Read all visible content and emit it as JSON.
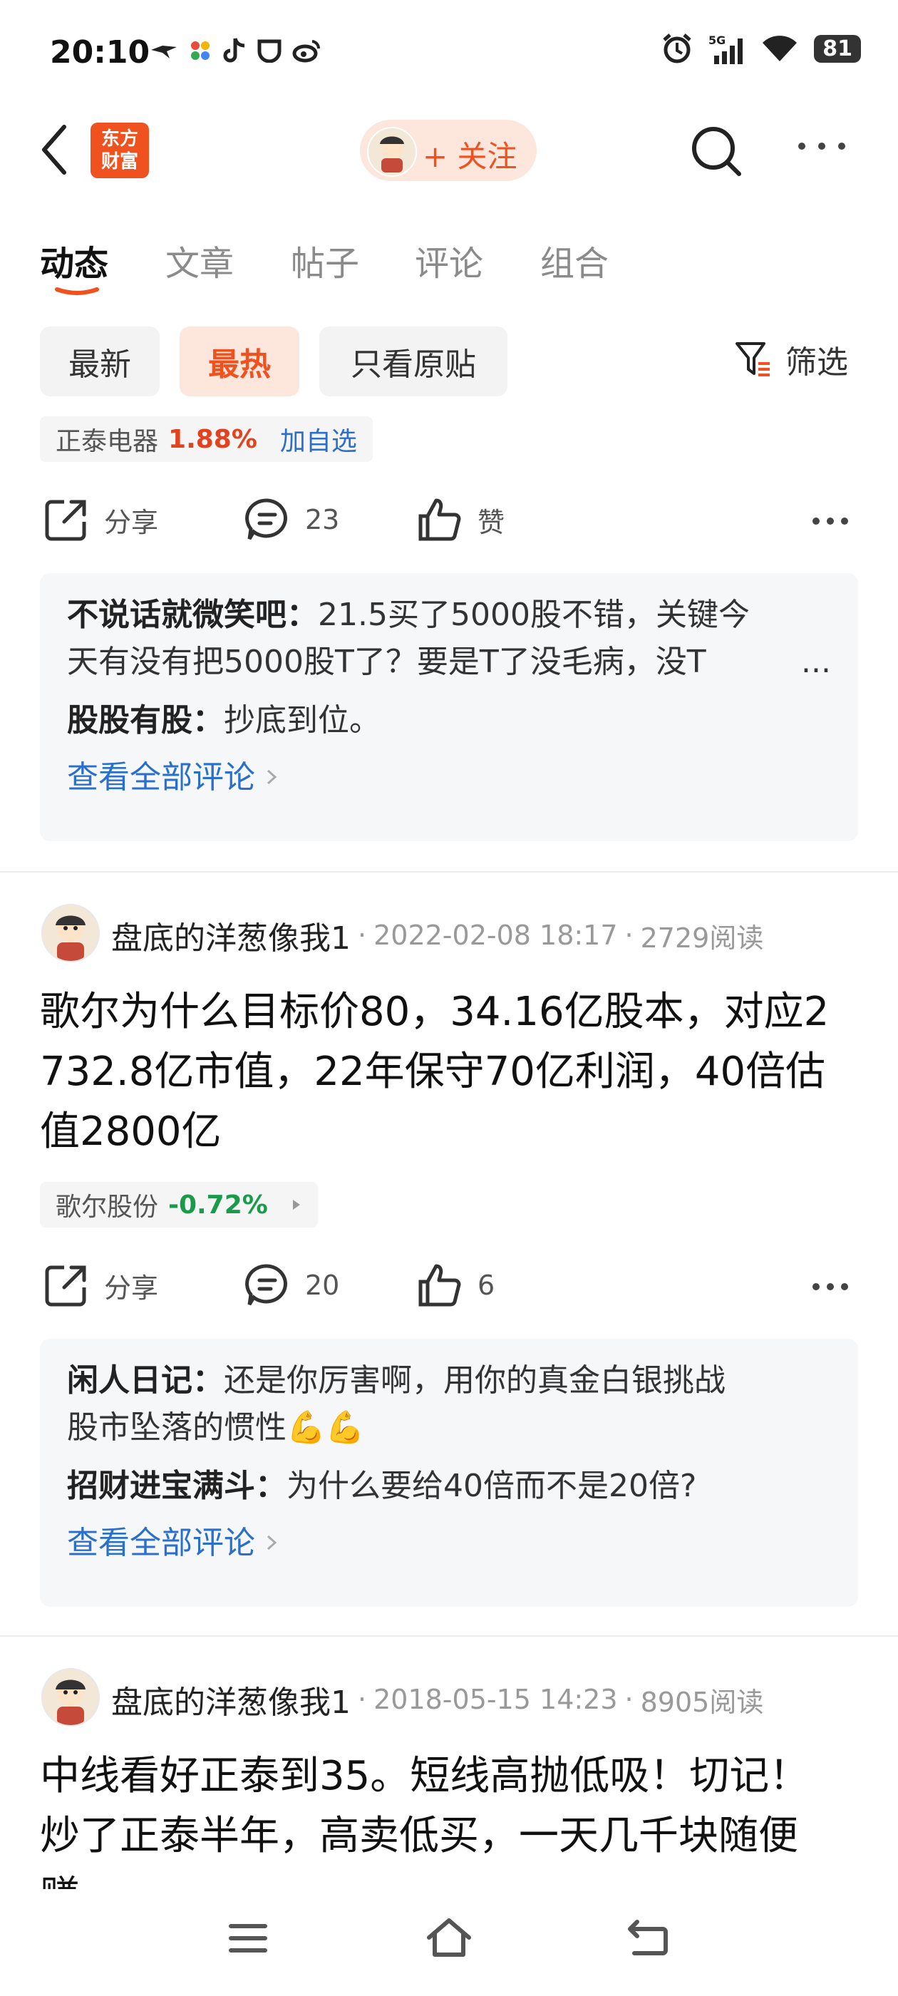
{
  "status_bar": {
    "time": "20:10",
    "battery": "81",
    "network": "5G"
  },
  "header": {
    "app_logo_line1": "东方",
    "app_logo_line2": "财富",
    "follow_label": "+ 关注"
  },
  "tabs": [
    {
      "label": "动态",
      "active": true
    },
    {
      "label": "文章"
    },
    {
      "label": "帖子"
    },
    {
      "label": "评论"
    },
    {
      "label": "组合"
    }
  ],
  "filters": {
    "newest": "最新",
    "hottest": "最热",
    "original_only": "只看原贴",
    "filter_label": "筛选"
  },
  "post0": {
    "stock": {
      "name": "正泰电器",
      "change": "1.88%",
      "add_label": "加自选"
    },
    "actions": {
      "share": "分享",
      "comments": "23",
      "like": "赞"
    },
    "comments": [
      {
        "user": "不说话就微笑吧：",
        "text_line1": "21.5买了5000股不错，关键今",
        "text_line2": "天有没有把5000股T了？要是T了没毛病，没T",
        "ellipsis": "..."
      },
      {
        "user": "股股有股：",
        "text": "抄底到位。"
      }
    ],
    "see_all": "查看全部评论"
  },
  "post1": {
    "author": "盘底的洋葱像我1",
    "date": "2022-02-08 18:17",
    "reads": "2729阅读",
    "text_line1": "歌尔为什么目标价80，34.16亿股本，对应2",
    "text_line2": "732.8亿市值，22年保守70亿利润，40倍估",
    "text_line3": "值2800亿",
    "stock": {
      "name": "歌尔股份",
      "change": "-0.72%"
    },
    "actions": {
      "share": "分享",
      "comments": "20",
      "like": "6"
    },
    "comments": [
      {
        "user": "闲人日记：",
        "text_line1": "还是你厉害啊，用你的真金白银挑战",
        "text_line2": "股市坠落的惯性",
        "emoji": "💪💪"
      },
      {
        "user": "招财进宝满斗：",
        "text": "为什么要给40倍而不是20倍?"
      }
    ],
    "see_all": "查看全部评论"
  },
  "post2": {
    "author": "盘底的洋葱像我1",
    "date": "2018-05-15 14:23",
    "reads": "8905阅读",
    "text_line1": "中线看好正泰到35。短线高抛低吸！切记！",
    "text_line2": "炒了正泰半年，高卖低买，一天几千块随便",
    "text_line3": "赚"
  },
  "colors": {
    "brand": "#f0521f",
    "link": "#2a6fc9",
    "up": "#e2421e",
    "down": "#1a9b4b"
  }
}
